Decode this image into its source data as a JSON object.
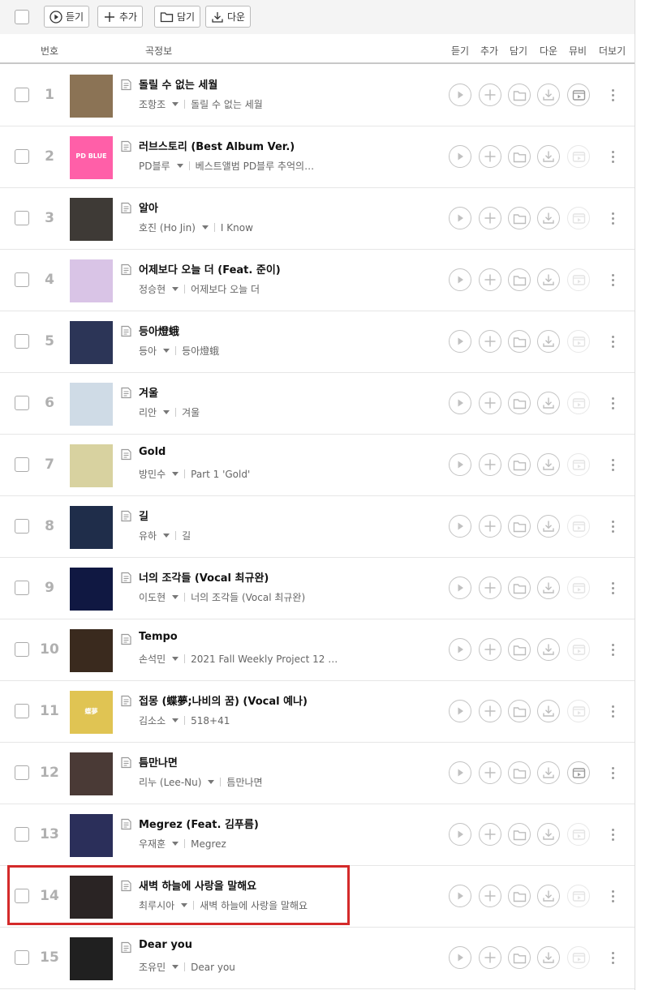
{
  "toolbar": {
    "listen_label": "듣기",
    "add_label": "추가",
    "save_label": "담기",
    "download_label": "다운"
  },
  "columns": {
    "number": "번호",
    "info": "곡정보",
    "listen": "듣기",
    "add": "추가",
    "save": "담기",
    "download": "다운",
    "mv": "뮤비",
    "more": "더보기"
  },
  "icons": {
    "play": "play-icon",
    "add": "plus-icon",
    "save": "folder-icon",
    "download": "download-icon",
    "mv": "music-video-icon",
    "more": "more-vertical-icon",
    "lyrics": "lyrics-note-icon"
  },
  "colors": {
    "highlight_box": "#d42a2a",
    "rank_text": "#b0b0b0",
    "toolbar_bg": "#f4f4f4"
  },
  "songs": [
    {
      "rank": "1",
      "title": "돌릴 수 없는 세월",
      "artist": "조항조",
      "album": "돌릴 수 없는 세월",
      "mv_enabled": true,
      "art": "#8b7355"
    },
    {
      "rank": "2",
      "title": "러브스토리 (Best Album Ver.)",
      "artist": "PD블루",
      "album": "베스트앨범 PD블루 추억의…",
      "mv_enabled": false,
      "art": "#ff5fa8",
      "art_text": "PD BLUE"
    },
    {
      "rank": "3",
      "title": "알아",
      "artist": "호진 (Ho Jin)",
      "album": "I Know",
      "mv_enabled": false,
      "art": "#3e3a36"
    },
    {
      "rank": "4",
      "title": "어제보다 오늘 더 (Feat. 준이)",
      "artist": "정승현",
      "album": "어제보다 오늘 더",
      "mv_enabled": false,
      "art": "#d9c4e6"
    },
    {
      "rank": "5",
      "title": "등아燈蛾",
      "artist": "등아",
      "album": "등아燈蛾",
      "mv_enabled": false,
      "art": "#2c3557"
    },
    {
      "rank": "6",
      "title": "겨울",
      "artist": "리안",
      "album": "겨울",
      "mv_enabled": false,
      "art": "#cfdbe6"
    },
    {
      "rank": "7",
      "title": "Gold",
      "artist": "방민수",
      "album": "Part 1 'Gold'",
      "mv_enabled": false,
      "art": "#d8d2a0"
    },
    {
      "rank": "8",
      "title": "길",
      "artist": "유하",
      "album": "길",
      "mv_enabled": false,
      "art": "#1f2d4a"
    },
    {
      "rank": "9",
      "title": "너의 조각들 (Vocal 최규완)",
      "artist": "이도현",
      "album": "너의 조각들 (Vocal 최규완)",
      "mv_enabled": false,
      "art": "#101842"
    },
    {
      "rank": "10",
      "title": "Tempo",
      "artist": "손석민",
      "album": "2021 Fall Weekly Project 12 …",
      "mv_enabled": false,
      "art": "#3a2a1e"
    },
    {
      "rank": "11",
      "title": "접몽 (蝶夢;나비의 꿈) (Vocal 예나)",
      "artist": "김소소",
      "album": "518+41",
      "mv_enabled": false,
      "art": "#e0c453",
      "art_text": "蝶夢"
    },
    {
      "rank": "12",
      "title": "틈만나면",
      "artist": "리누 (Lee-Nu)",
      "album": "틈만나면",
      "mv_enabled": true,
      "art": "#4a3a36"
    },
    {
      "rank": "13",
      "title": "Megrez (Feat. 김푸름)",
      "artist": "우재훈",
      "album": "Megrez",
      "mv_enabled": false,
      "art": "#2b2f5a"
    },
    {
      "rank": "14",
      "title": "새벽 하늘에 사랑을 말해요",
      "artist": "최루시아",
      "album": "새벽 하늘에 사랑을 말해요",
      "mv_enabled": false,
      "art": "#2a2424"
    },
    {
      "rank": "15",
      "title": "Dear you",
      "artist": "조유민",
      "album": "Dear you",
      "mv_enabled": false,
      "art": "#202020"
    }
  ]
}
